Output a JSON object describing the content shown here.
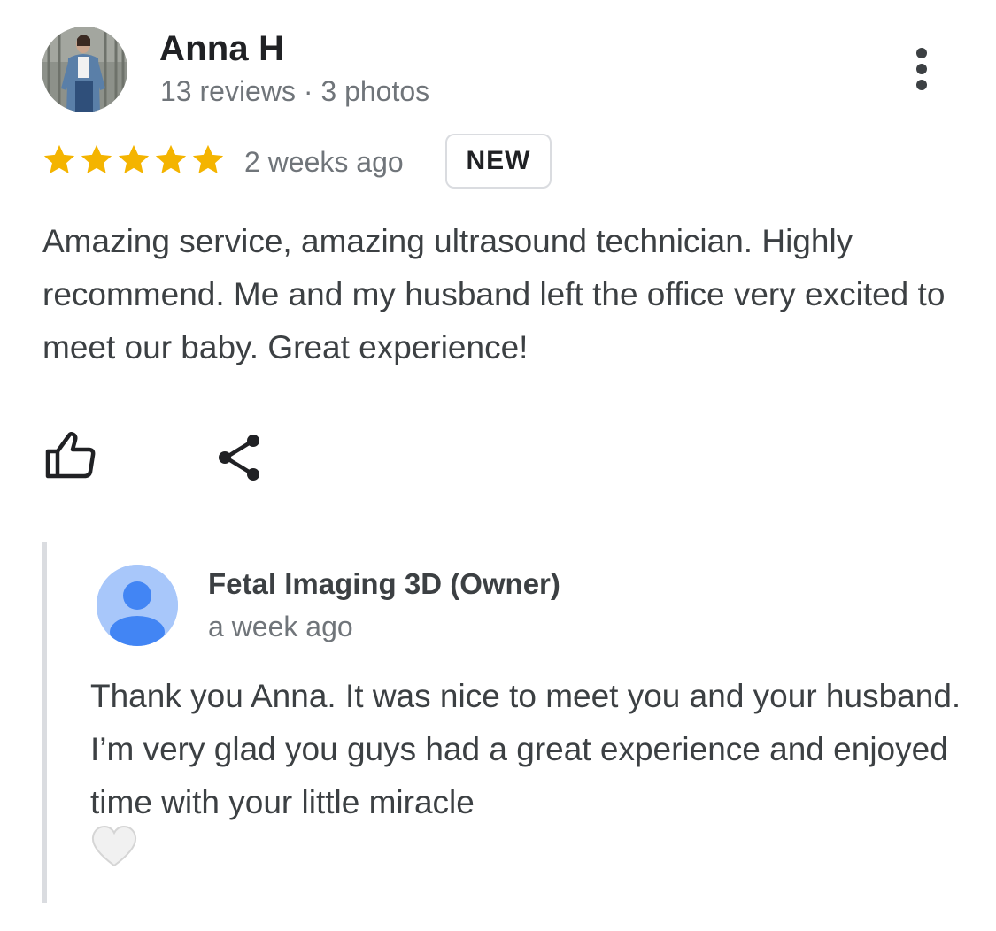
{
  "review": {
    "author": {
      "name": "Anna H",
      "meta": "13 reviews · 3 photos"
    },
    "rating": {
      "stars": 5,
      "max_stars": 5,
      "star_color": "#f4b400",
      "time_ago": "2 weeks ago",
      "badge": "NEW"
    },
    "text": "Amazing service, amazing ultrasound technician. Highly recommend. Me and my husband left the office very excited to meet our baby. Great experience!",
    "actions": {
      "like_icon": "thumbs-up-icon",
      "share_icon": "share-icon",
      "more_icon": "more-vert-icon"
    }
  },
  "owner_reply": {
    "name": "Fetal Imaging 3D (Owner)",
    "time_ago": "a week ago",
    "text": "Thank you Anna. It was nice to meet you and your husband. I’m very glad you guys had a great experience and enjoyed time with your little miracle",
    "emoji": "white-heart-icon",
    "avatar_color": "#a8c7fa",
    "avatar_figure_color": "#4285f4"
  }
}
